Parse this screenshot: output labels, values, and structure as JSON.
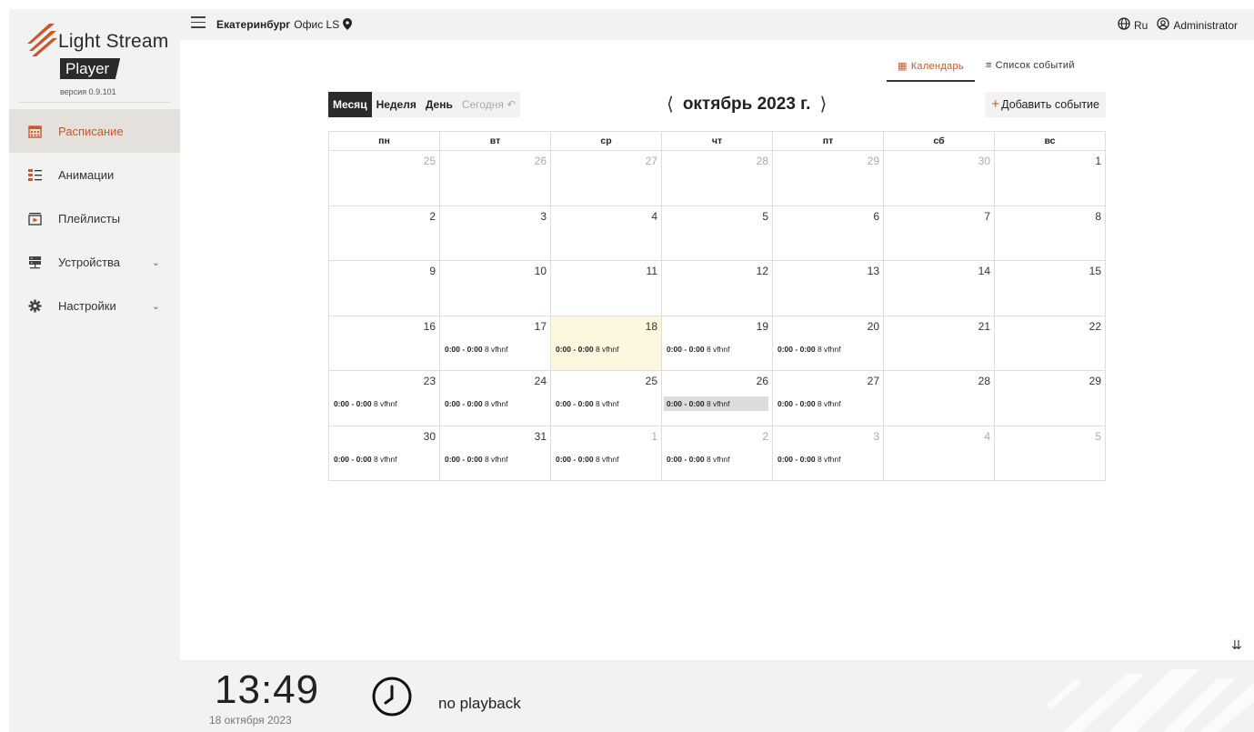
{
  "app": {
    "brand": "Light Stream",
    "product": "Player",
    "version": "версия 0.9.101"
  },
  "sidebar": {
    "items": [
      {
        "label": "Расписание",
        "icon": "calendar-icon",
        "active": true
      },
      {
        "label": "Анимации",
        "icon": "list-icon"
      },
      {
        "label": "Плейлисты",
        "icon": "playlist-icon"
      },
      {
        "label": "Устройства",
        "icon": "server-icon",
        "expandable": true
      },
      {
        "label": "Настройки",
        "icon": "gear-icon",
        "expandable": true
      }
    ]
  },
  "topbar": {
    "city": "Екатеринбург",
    "office": "Офис LS",
    "language": "Ru",
    "user": "Administrator"
  },
  "view_tabs": {
    "calendar": "Календарь",
    "events": "Список событий"
  },
  "toolbar": {
    "month": "Месяц",
    "week": "Неделя",
    "day": "День",
    "today": "Сегодня",
    "title": "октябрь 2023 г.",
    "add": "Добавить событие"
  },
  "calendar": {
    "weekdays": [
      "пн",
      "вт",
      "ср",
      "чт",
      "пт",
      "сб",
      "вс"
    ],
    "weeks": [
      [
        {
          "d": "25",
          "m": true
        },
        {
          "d": "26",
          "m": true
        },
        {
          "d": "27",
          "m": true
        },
        {
          "d": "28",
          "m": true
        },
        {
          "d": "29",
          "m": true
        },
        {
          "d": "30",
          "m": true
        },
        {
          "d": "1"
        }
      ],
      [
        {
          "d": "2"
        },
        {
          "d": "3"
        },
        {
          "d": "4"
        },
        {
          "d": "5"
        },
        {
          "d": "6"
        },
        {
          "d": "7"
        },
        {
          "d": "8"
        }
      ],
      [
        {
          "d": "9"
        },
        {
          "d": "10"
        },
        {
          "d": "11"
        },
        {
          "d": "12"
        },
        {
          "d": "13"
        },
        {
          "d": "14"
        },
        {
          "d": "15"
        }
      ],
      [
        {
          "d": "16"
        },
        {
          "d": "17",
          "ev": true
        },
        {
          "d": "18",
          "ev": true,
          "today": true
        },
        {
          "d": "19",
          "ev": true
        },
        {
          "d": "20",
          "ev": true
        },
        {
          "d": "21"
        },
        {
          "d": "22"
        }
      ],
      [
        {
          "d": "23",
          "ev": true
        },
        {
          "d": "24",
          "ev": true
        },
        {
          "d": "25",
          "ev": true
        },
        {
          "d": "26",
          "ev": true,
          "sel": true
        },
        {
          "d": "27",
          "ev": true
        },
        {
          "d": "28"
        },
        {
          "d": "29"
        }
      ],
      [
        {
          "d": "30",
          "ev": true
        },
        {
          "d": "31",
          "ev": true
        },
        {
          "d": "1",
          "m": true,
          "ev": true
        },
        {
          "d": "2",
          "m": true,
          "ev": true
        },
        {
          "d": "3",
          "m": true,
          "ev": true
        },
        {
          "d": "4",
          "m": true
        },
        {
          "d": "5",
          "m": true
        }
      ]
    ],
    "event_time": "0:00 - 0:00",
    "event_name": "8 vfhnf"
  },
  "footer": {
    "time": "13:49",
    "date": "18 октября 2023",
    "status": "no playback"
  },
  "colors": {
    "accent": "#c9572a",
    "dark": "#2b2b2b",
    "panel": "#f2f2f2",
    "today": "#fcf7df"
  }
}
